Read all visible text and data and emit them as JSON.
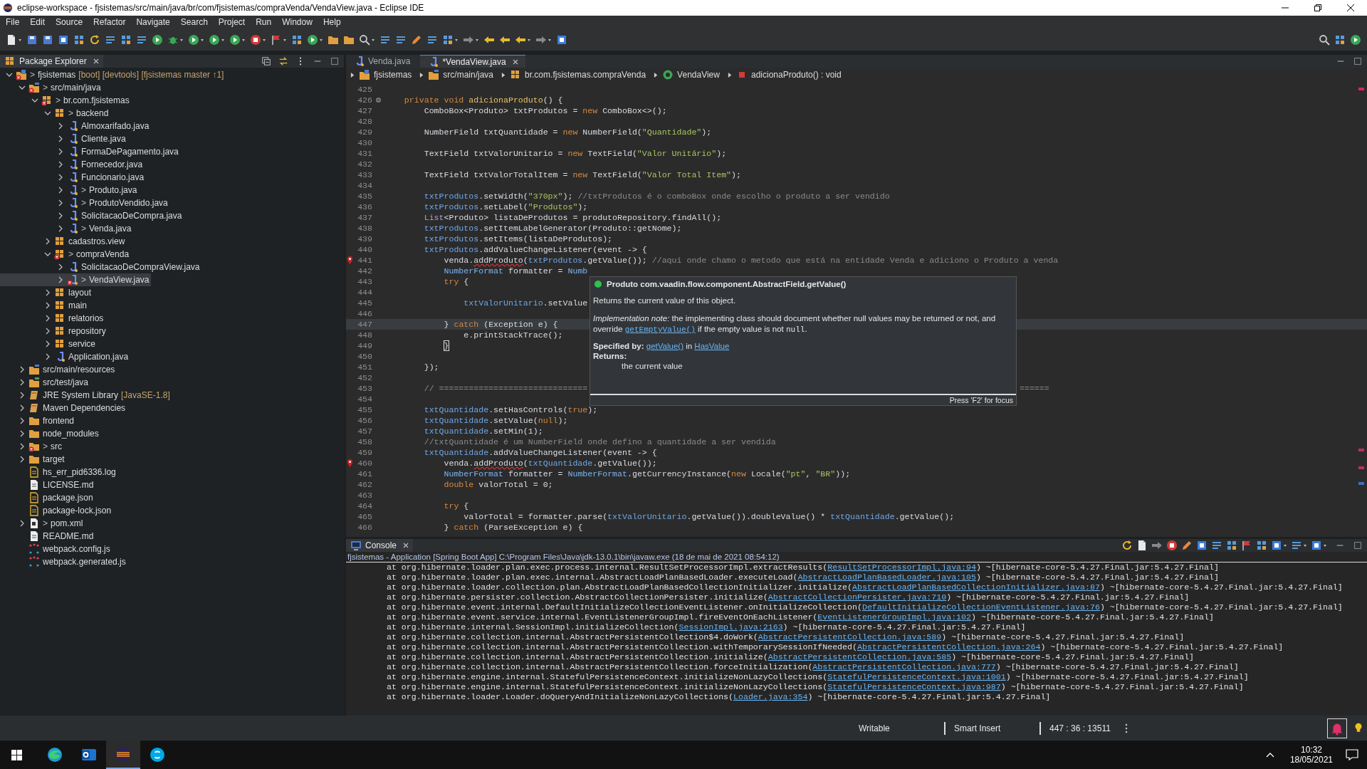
{
  "window": {
    "title": "eclipse-workspace - fjsistemas/src/main/java/br/com/fjsistemas/compraVenda/VendaView.java - Eclipse IDE"
  },
  "menu": [
    "File",
    "Edit",
    "Source",
    "Refactor",
    "Navigate",
    "Search",
    "Project",
    "Run",
    "Window",
    "Help"
  ],
  "explorer": {
    "title": "Package Explorer",
    "tree": [
      {
        "kind": "project",
        "prefix": ">",
        "label": "fjsistemas",
        "suffix": "[boot] [devtools] [fjsistemas master ↑1]",
        "error": true,
        "expanded": true,
        "selected": false,
        "children": [
          {
            "kind": "source-folder",
            "prefix": ">",
            "label": "src/main/java",
            "error": true,
            "expanded": true,
            "selected": false,
            "children": [
              {
                "kind": "package",
                "prefix": ">",
                "label": "br.com.fjsistemas",
                "error": true,
                "expanded": true,
                "selected": false,
                "children": [
                  {
                    "kind": "package",
                    "prefix": ">",
                    "label": "backend",
                    "error": false,
                    "expanded": true,
                    "selected": false,
                    "children": [
                      {
                        "kind": "java",
                        "label": "Almoxarifado.java",
                        "error": false,
                        "expanded": false,
                        "selected": false
                      },
                      {
                        "kind": "java",
                        "label": "Cliente.java",
                        "error": false,
                        "expanded": false,
                        "selected": false
                      },
                      {
                        "kind": "java",
                        "label": "FormaDePagamento.java",
                        "error": false,
                        "expanded": false,
                        "selected": false
                      },
                      {
                        "kind": "java",
                        "label": "Fornecedor.java",
                        "error": false,
                        "expanded": false,
                        "selected": false
                      },
                      {
                        "kind": "java",
                        "label": "Funcionario.java",
                        "error": false,
                        "expanded": false,
                        "selected": false
                      },
                      {
                        "kind": "java",
                        "prefix": ">",
                        "label": "Produto.java",
                        "error": false,
                        "expanded": false,
                        "selected": false
                      },
                      {
                        "kind": "java",
                        "prefix": ">",
                        "label": "ProdutoVendido.java",
                        "error": false,
                        "expanded": false,
                        "selected": false
                      },
                      {
                        "kind": "java",
                        "label": "SolicitacaoDeCompra.java",
                        "error": false,
                        "expanded": false,
                        "selected": false
                      },
                      {
                        "kind": "java",
                        "prefix": ">",
                        "label": "Venda.java",
                        "error": false,
                        "expanded": false,
                        "selected": false
                      }
                    ]
                  },
                  {
                    "kind": "package",
                    "label": "cadastros.view",
                    "error": false,
                    "expanded": false,
                    "selected": false
                  },
                  {
                    "kind": "package",
                    "prefix": ">",
                    "label": "compraVenda",
                    "error": true,
                    "expanded": true,
                    "selected": false,
                    "children": [
                      {
                        "kind": "java",
                        "label": "SolicitacaoDeCompraView.java",
                        "error": false,
                        "expanded": false,
                        "selected": false
                      },
                      {
                        "kind": "java",
                        "prefix": ">",
                        "label": "VendaView.java",
                        "error": true,
                        "expanded": false,
                        "selected": true
                      }
                    ]
                  },
                  {
                    "kind": "package",
                    "label": "layout",
                    "error": false,
                    "expanded": false,
                    "selected": false
                  },
                  {
                    "kind": "package",
                    "label": "main",
                    "error": false,
                    "expanded": false,
                    "selected": false
                  },
                  {
                    "kind": "package",
                    "label": "relatorios",
                    "error": false,
                    "expanded": false,
                    "selected": false
                  },
                  {
                    "kind": "package",
                    "label": "repository",
                    "error": false,
                    "expanded": false,
                    "selected": false
                  },
                  {
                    "kind": "package",
                    "label": "service",
                    "error": false,
                    "expanded": false,
                    "selected": false
                  },
                  {
                    "kind": "java",
                    "label": "Application.java",
                    "error": false,
                    "expanded": false,
                    "selected": false
                  }
                ]
              }
            ]
          },
          {
            "kind": "source-folder",
            "label": "src/main/resources",
            "error": false,
            "expanded": false,
            "selected": false
          },
          {
            "kind": "test-folder",
            "label": "src/test/java",
            "error": false,
            "expanded": false,
            "selected": false
          },
          {
            "kind": "library",
            "label": "JRE System Library",
            "suffix": "[JavaSE-1.8]",
            "error": false,
            "expanded": false,
            "selected": false
          },
          {
            "kind": "library",
            "label": "Maven Dependencies",
            "error": false,
            "expanded": false,
            "selected": false
          },
          {
            "kind": "folder",
            "label": "frontend",
            "error": false,
            "expanded": false,
            "selected": false
          },
          {
            "kind": "folder",
            "label": "node_modules",
            "error": false,
            "expanded": false,
            "selected": false
          },
          {
            "kind": "folder",
            "prefix": ">",
            "label": "src",
            "error": true,
            "expanded": false,
            "selected": false
          },
          {
            "kind": "folder",
            "label": "target",
            "error": false,
            "expanded": false,
            "selected": false
          },
          {
            "kind": "log",
            "label": "hs_err_pid6336.log",
            "error": false,
            "selected": false
          },
          {
            "kind": "text",
            "label": "LICENSE.md",
            "error": false,
            "selected": false
          },
          {
            "kind": "log",
            "label": "package.json",
            "error": false,
            "selected": false
          },
          {
            "kind": "log",
            "label": "package-lock.json",
            "error": false,
            "selected": false
          },
          {
            "kind": "pom",
            "prefix": ">",
            "label": "pom.xml",
            "error": false,
            "expanded": false,
            "selected": false
          },
          {
            "kind": "text",
            "label": "README.md",
            "error": false,
            "selected": false
          },
          {
            "kind": "webpack",
            "label": "webpack.config.js",
            "error": false,
            "selected": false
          },
          {
            "kind": "webpack",
            "label": "webpack.generated.js",
            "error": false,
            "selected": false
          }
        ]
      }
    ]
  },
  "editor": {
    "tabs": [
      {
        "label": "Venda.java",
        "selected": false
      },
      {
        "label": "*VendaView.java",
        "selected": true
      }
    ],
    "breadcrumb": [
      {
        "kind": "project",
        "label": "fjsistemas"
      },
      {
        "kind": "source-folder",
        "label": "src/main/java"
      },
      {
        "kind": "package",
        "label": "br.com.fjsistemas.compraVenda"
      },
      {
        "kind": "class",
        "label": "VendaView"
      },
      {
        "kind": "method",
        "label": "adicionaProduto() : void"
      }
    ],
    "lines": [
      {
        "n": "425",
        "error": false,
        "fold": false,
        "current": false
      },
      {
        "n": "426",
        "error": false,
        "fold": true,
        "current": false,
        "tokens": [
          {
            "kind": "kw",
            "t": "    private void "
          },
          {
            "kind": "decl",
            "t": "adicionaProduto"
          },
          {
            "kind": "plain",
            "t": "() {"
          }
        ]
      },
      {
        "n": "427",
        "error": false,
        "fold": false,
        "current": false,
        "tokens": [
          {
            "kind": "plain",
            "t": "        ComboBox<Produto> txtProdutos = "
          },
          {
            "kind": "kw",
            "t": "new"
          },
          {
            "kind": "plain",
            "t": " ComboBox<>();"
          }
        ]
      },
      {
        "n": "428",
        "error": false,
        "fold": false,
        "current": false
      },
      {
        "n": "429",
        "error": false,
        "fold": false,
        "current": false,
        "tokens": [
          {
            "kind": "plain",
            "t": "        NumberField txtQuantidade = "
          },
          {
            "kind": "kw",
            "t": "new"
          },
          {
            "kind": "plain",
            "t": " NumberField("
          },
          {
            "kind": "str",
            "t": "\"Quantidade\""
          },
          {
            "kind": "plain",
            "t": ");"
          }
        ]
      },
      {
        "n": "430",
        "error": false,
        "fold": false,
        "current": false
      },
      {
        "n": "431",
        "error": false,
        "fold": false,
        "current": false,
        "tokens": [
          {
            "kind": "plain",
            "t": "        TextField txtValorUnitario = "
          },
          {
            "kind": "kw",
            "t": "new"
          },
          {
            "kind": "plain",
            "t": " TextField("
          },
          {
            "kind": "str",
            "t": "\"Valor Unitário\""
          },
          {
            "kind": "plain",
            "t": ");"
          }
        ]
      },
      {
        "n": "432",
        "error": false,
        "fold": false,
        "current": false
      },
      {
        "n": "433",
        "error": false,
        "fold": false,
        "current": false,
        "tokens": [
          {
            "kind": "plain",
            "t": "        TextField txtValorTotalItem = "
          },
          {
            "kind": "kw",
            "t": "new"
          },
          {
            "kind": "plain",
            "t": " TextField("
          },
          {
            "kind": "str",
            "t": "\"Valor Total Item\""
          },
          {
            "kind": "plain",
            "t": ");"
          }
        ]
      },
      {
        "n": "434",
        "error": false,
        "fold": false,
        "current": false
      },
      {
        "n": "435",
        "error": false,
        "fold": false,
        "current": false,
        "tokens": [
          {
            "kind": "field",
            "t": "        txtProdutos"
          },
          {
            "kind": "plain",
            "t": ".setWidth("
          },
          {
            "kind": "str",
            "t": "\"370px\""
          },
          {
            "kind": "plain",
            "t": ");"
          },
          {
            "kind": "comment",
            "t": " //txtProdutos é o comboBox onde escolho o produto a ser vendido"
          }
        ]
      },
      {
        "n": "436",
        "error": false,
        "fold": false,
        "current": false,
        "tokens": [
          {
            "kind": "field",
            "t": "        txtProdutos"
          },
          {
            "kind": "plain",
            "t": ".setLabel("
          },
          {
            "kind": "str",
            "t": "\"Produtos\""
          },
          {
            "kind": "plain",
            "t": ");"
          }
        ]
      },
      {
        "n": "437",
        "error": false,
        "fold": false,
        "current": false,
        "tokens": [
          {
            "kind": "iface",
            "t": "        List"
          },
          {
            "kind": "plain",
            "t": "<Produto> listaDeProdutos = produtoRepository.findAll();"
          }
        ]
      },
      {
        "n": "438",
        "error": false,
        "fold": false,
        "current": false,
        "tokens": [
          {
            "kind": "field",
            "t": "        txtProdutos"
          },
          {
            "kind": "plain",
            "t": ".setItemLabelGenerator(Produto::getNome);"
          }
        ]
      },
      {
        "n": "439",
        "error": false,
        "fold": false,
        "current": false,
        "tokens": [
          {
            "kind": "field",
            "t": "        txtProdutos"
          },
          {
            "kind": "plain",
            "t": ".setItems(listaDeProdutos);"
          }
        ]
      },
      {
        "n": "440",
        "error": false,
        "fold": false,
        "current": false,
        "tokens": [
          {
            "kind": "field",
            "t": "        txtProdutos"
          },
          {
            "kind": "plain",
            "t": ".addValueChangeListener(event -> {"
          }
        ]
      },
      {
        "n": "441",
        "error": true,
        "fold": false,
        "current": false,
        "tokens": [
          {
            "kind": "plain",
            "t": "            venda."
          },
          {
            "kind": "bad",
            "t": "addProduto"
          },
          {
            "kind": "plain",
            "t": "("
          },
          {
            "kind": "field",
            "t": "txtProdutos"
          },
          {
            "kind": "plain",
            "t": ".getValue());"
          },
          {
            "kind": "comment",
            "t": " //aqui onde chamo o metodo que está na entidade Venda e adiciono o Produto a venda"
          }
        ]
      },
      {
        "n": "442",
        "error": false,
        "fold": false,
        "current": false,
        "tokens": [
          {
            "kind": "type",
            "t": "            NumberFormat"
          },
          {
            "kind": "plain",
            "t": " formatter = "
          },
          {
            "kind": "type",
            "t": "Numb"
          }
        ]
      },
      {
        "n": "443",
        "error": false,
        "fold": false,
        "current": false,
        "tokens": [
          {
            "kind": "kw",
            "t": "            try"
          },
          {
            "kind": "plain",
            "t": " {"
          }
        ]
      },
      {
        "n": "444",
        "error": false,
        "fold": false,
        "current": false
      },
      {
        "n": "445",
        "error": false,
        "fold": false,
        "current": false,
        "tokens": [
          {
            "kind": "field",
            "t": "                txtValorUnitario"
          },
          {
            "kind": "plain",
            "t": ".setValue"
          }
        ]
      },
      {
        "n": "446",
        "error": false,
        "fold": false,
        "current": false
      },
      {
        "n": "447",
        "error": false,
        "fold": false,
        "current": true,
        "tokens": [
          {
            "kind": "plain",
            "t": "            }"
          },
          {
            "kind": "kw",
            "t": " catch"
          },
          {
            "kind": "plain",
            "t": " (Exception e) {"
          }
        ]
      },
      {
        "n": "448",
        "error": false,
        "fold": false,
        "current": false,
        "tokens": [
          {
            "kind": "plain",
            "t": "                e.printStackTrace();"
          }
        ]
      },
      {
        "n": "449",
        "error": false,
        "fold": false,
        "current": false,
        "tokens": [
          {
            "kind": "match",
            "t": "            }"
          }
        ]
      },
      {
        "n": "450",
        "error": false,
        "fold": false,
        "current": false
      },
      {
        "n": "451",
        "error": false,
        "fold": false,
        "current": false,
        "tokens": [
          {
            "kind": "plain",
            "t": "        });"
          }
        ]
      },
      {
        "n": "452",
        "error": false,
        "fold": false,
        "current": false
      },
      {
        "n": "453",
        "error": false,
        "fold": false,
        "current": false,
        "tokens": [
          {
            "kind": "comment",
            "t": "        // =============================="
          }
        ],
        "tail": "======"
      },
      {
        "n": "454",
        "error": false,
        "fold": false,
        "current": false
      },
      {
        "n": "455",
        "error": false,
        "fold": false,
        "current": false,
        "tokens": [
          {
            "kind": "field",
            "t": "        txtQuantidade"
          },
          {
            "kind": "plain",
            "t": ".setHasControls("
          },
          {
            "kind": "kw",
            "t": "true"
          },
          {
            "kind": "plain",
            "t": ");"
          }
        ]
      },
      {
        "n": "456",
        "error": false,
        "fold": false,
        "current": false,
        "tokens": [
          {
            "kind": "field",
            "t": "        txtQuantidade"
          },
          {
            "kind": "plain",
            "t": ".setValue("
          },
          {
            "kind": "kw",
            "t": "null"
          },
          {
            "kind": "plain",
            "t": ");"
          }
        ]
      },
      {
        "n": "457",
        "error": false,
        "fold": false,
        "current": false,
        "tokens": [
          {
            "kind": "field",
            "t": "        txtQuantidade"
          },
          {
            "kind": "plain",
            "t": ".setMin(1);"
          }
        ]
      },
      {
        "n": "458",
        "error": false,
        "fold": false,
        "current": false,
        "tokens": [
          {
            "kind": "comment",
            "t": "        //txtQuantidade é um NumberField onde defino a quantidade a ser vendida"
          }
        ]
      },
      {
        "n": "459",
        "error": false,
        "fold": false,
        "current": false,
        "tokens": [
          {
            "kind": "field",
            "t": "        txtQuantidade"
          },
          {
            "kind": "plain",
            "t": ".addValueChangeListener(event -> {"
          }
        ]
      },
      {
        "n": "460",
        "error": true,
        "fold": false,
        "current": false,
        "tokens": [
          {
            "kind": "plain",
            "t": "            venda."
          },
          {
            "kind": "bad",
            "t": "addProduto"
          },
          {
            "kind": "plain",
            "t": "("
          },
          {
            "kind": "field",
            "t": "txtQuantidade"
          },
          {
            "kind": "plain",
            "t": ".getValue());"
          }
        ]
      },
      {
        "n": "461",
        "error": false,
        "fold": false,
        "current": false,
        "tokens": [
          {
            "kind": "type",
            "t": "            NumberFormat"
          },
          {
            "kind": "plain",
            "t": " formatter = "
          },
          {
            "kind": "type",
            "t": "NumberFormat"
          },
          {
            "kind": "plain",
            "t": ".getCurrencyInstance("
          },
          {
            "kind": "kw",
            "t": "new"
          },
          {
            "kind": "plain",
            "t": " Locale("
          },
          {
            "kind": "str",
            "t": "\"pt\""
          },
          {
            "kind": "plain",
            "t": ","
          },
          {
            "kind": "str",
            "t": " \"BR\""
          },
          {
            "kind": "plain",
            "t": "));"
          }
        ]
      },
      {
        "n": "462",
        "error": false,
        "fold": false,
        "current": false,
        "tokens": [
          {
            "kind": "kw",
            "t": "            double"
          },
          {
            "kind": "plain",
            "t": " valorTotal = 0;"
          }
        ]
      },
      {
        "n": "463",
        "error": false,
        "fold": false,
        "current": false
      },
      {
        "n": "464",
        "error": false,
        "fold": false,
        "current": false,
        "tokens": [
          {
            "kind": "kw",
            "t": "            try"
          },
          {
            "kind": "plain",
            "t": " {"
          }
        ]
      },
      {
        "n": "465",
        "error": false,
        "fold": false,
        "current": false,
        "tokens": [
          {
            "kind": "plain",
            "t": "                valorTotal = formatter.parse("
          },
          {
            "kind": "field",
            "t": "txtValorUnitario"
          },
          {
            "kind": "plain",
            "t": ".getValue()).doubleValue() *"
          },
          {
            "kind": "field",
            "t": " txtQuantidade"
          },
          {
            "kind": "plain",
            "t": ".getValue();"
          }
        ]
      },
      {
        "n": "466",
        "error": false,
        "fold": false,
        "current": false,
        "tokens": [
          {
            "kind": "plain",
            "t": "            }"
          },
          {
            "kind": "kw",
            "t": " catch"
          },
          {
            "kind": "plain",
            "t": " (ParseException e) {"
          }
        ]
      }
    ],
    "popup": {
      "title": "Produto com.vaadin.flow.component.AbstractField.getValue()",
      "summary": "Returns the current value of this object.",
      "note": {
        "before": "*Implementation note:* the implementing class should document whether null values may be returned or not, and override ",
        "link": "getEmptyValue()",
        "middle": " if the empty value is not ",
        "code": "null",
        "end": "."
      },
      "specified": {
        "label": "Specified by:",
        "link": "getValue()",
        "middle": " in ",
        "link2": "HasValue"
      },
      "returns_label": "Returns:",
      "returns": "the current value",
      "footer": "Press 'F2' for focus"
    }
  },
  "console": {
    "title": "Console",
    "launch": "fjsistemas - Application [Spring Boot App] C:\\Program Files\\Java\\jdk-13.0.1\\bin\\javaw.exe  (18 de mai de 2021 08:54:12)",
    "lines": [
      {
        "call": "at org.hibernate.loader.plan.exec.process.internal.ResultSetProcessorImpl.extractResults(",
        "link": "ResultSetProcessorImpl.java:94",
        "tail": ") ~[hibernate-core-5.4.27.Final.jar:5.4.27.Final]"
      },
      {
        "call": "at org.hibernate.loader.plan.exec.internal.AbstractLoadPlanBasedLoader.executeLoad(",
        "link": "AbstractLoadPlanBasedLoader.java:105",
        "tail": ") ~[hibernate-core-5.4.27.Final.jar:5.4.27.Final]"
      },
      {
        "call": "at org.hibernate.loader.collection.plan.AbstractLoadPlanBasedCollectionInitializer.initialize(",
        "link": "AbstractLoadPlanBasedCollectionInitializer.java:87",
        "tail": ") ~[hibernate-core-5.4.27.Final.jar:5.4.27.Final]"
      },
      {
        "call": "at org.hibernate.persister.collection.AbstractCollectionPersister.initialize(",
        "link": "AbstractCollectionPersister.java:710",
        "tail": ") ~[hibernate-core-5.4.27.Final.jar:5.4.27.Final]"
      },
      {
        "call": "at org.hibernate.event.internal.DefaultInitializeCollectionEventListener.onInitializeCollection(",
        "link": "DefaultInitializeCollectionEventListener.java:76",
        "tail": ") ~[hibernate-core-5.4.27.Final.jar:5.4.27.Final]"
      },
      {
        "call": "at org.hibernate.event.service.internal.EventListenerGroupImpl.fireEventOnEachListener(",
        "link": "EventListenerGroupImpl.java:102",
        "tail": ") ~[hibernate-core-5.4.27.Final.jar:5.4.27.Final]"
      },
      {
        "call": "at org.hibernate.internal.SessionImpl.initializeCollection(",
        "link": "SessionImpl.java:2163",
        "tail": ") ~[hibernate-core-5.4.27.Final.jar:5.4.27.Final]"
      },
      {
        "call": "at org.hibernate.collection.internal.AbstractPersistentCollection$4.doWork(",
        "link": "AbstractPersistentCollection.java:589",
        "tail": ") ~[hibernate-core-5.4.27.Final.jar:5.4.27.Final]"
      },
      {
        "call": "at org.hibernate.collection.internal.AbstractPersistentCollection.withTemporarySessionIfNeeded(",
        "link": "AbstractPersistentCollection.java:264",
        "tail": ") ~[hibernate-core-5.4.27.Final.jar:5.4.27.Final]"
      },
      {
        "call": "at org.hibernate.collection.internal.AbstractPersistentCollection.initialize(",
        "link": "AbstractPersistentCollection.java:585",
        "tail": ") ~[hibernate-core-5.4.27.Final.jar:5.4.27.Final]"
      },
      {
        "call": "at org.hibernate.collection.internal.AbstractPersistentCollection.forceInitialization(",
        "link": "AbstractPersistentCollection.java:777",
        "tail": ") ~[hibernate-core-5.4.27.Final.jar:5.4.27.Final]"
      },
      {
        "call": "at org.hibernate.engine.internal.StatefulPersistenceContext.initializeNonLazyCollections(",
        "link": "StatefulPersistenceContext.java:1001",
        "tail": ") ~[hibernate-core-5.4.27.Final.jar:5.4.27.Final]"
      },
      {
        "call": "at org.hibernate.engine.internal.StatefulPersistenceContext.initializeNonLazyCollections(",
        "link": "StatefulPersistenceContext.java:987",
        "tail": ") ~[hibernate-core-5.4.27.Final.jar:5.4.27.Final]"
      },
      {
        "call": "at org.hibernate.loader.Loader.doQueryAndInitializeNonLazyCollections(",
        "link": "Loader.java:354",
        "tail": ") ~[hibernate-core-5.4.27.Final.jar:5.4.27.Final]"
      }
    ]
  },
  "status_bar": {
    "mode": "Writable",
    "insert": "Smart Insert",
    "position": "447 : 36 : 13511"
  },
  "taskbar": {
    "apps": [
      {
        "kind": "browser",
        "selected": false
      },
      {
        "kind": "mail",
        "selected": false
      },
      {
        "kind": "ide",
        "selected": true
      },
      {
        "kind": "chat",
        "selected": false
      }
    ],
    "time": "10:32",
    "date": "18/05/2021"
  }
}
